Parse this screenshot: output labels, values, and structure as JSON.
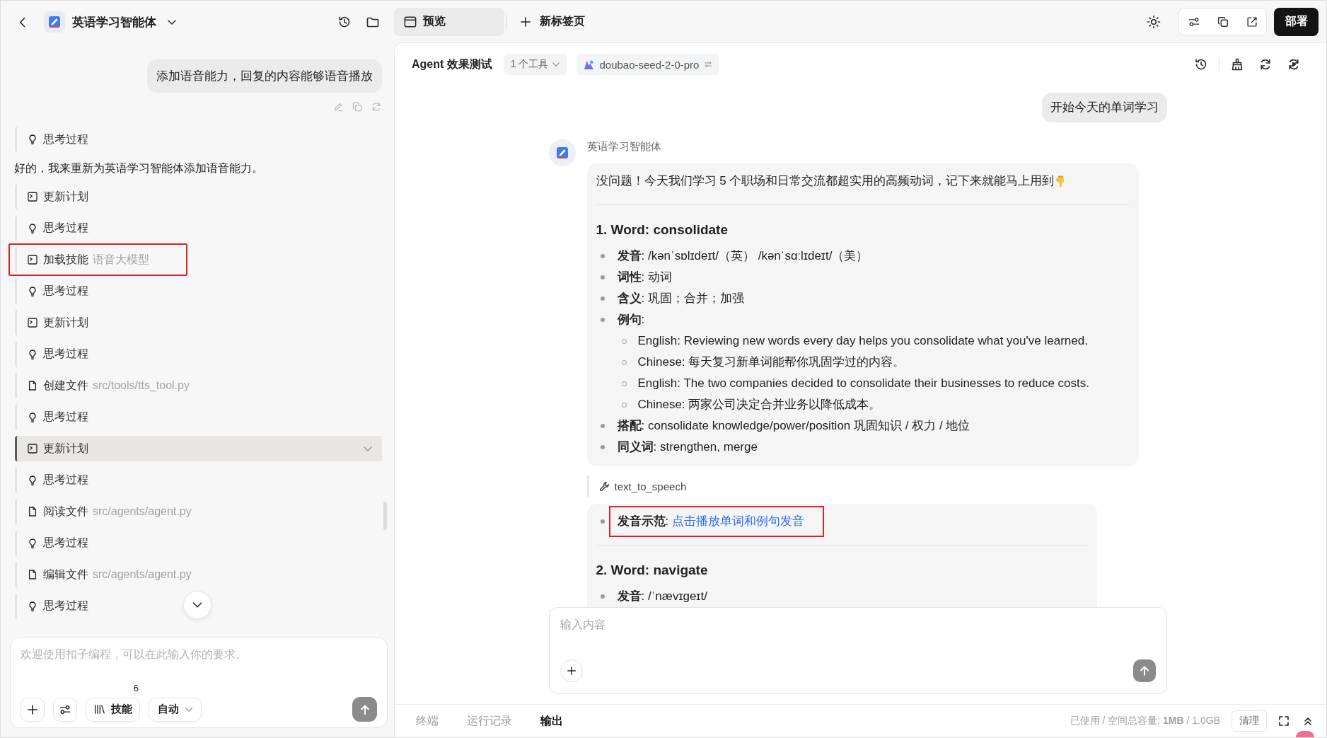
{
  "left_panel": {
    "title": "英语学习智能体",
    "user_message": "添加语音能力，回复的内容能够语音播放",
    "steps": [
      {
        "kind": "thinking",
        "label": "思考过程",
        "selected": false,
        "highlighted": false
      },
      {
        "kind": "text",
        "text": "好的，我来重新为英语学习智能体添加语音能力。"
      },
      {
        "kind": "plan",
        "label": "更新计划",
        "selected": false,
        "highlighted": false
      },
      {
        "kind": "thinking",
        "label": "思考过程",
        "selected": false,
        "highlighted": false
      },
      {
        "kind": "skill",
        "label": "加载技能",
        "detail": "语音大模型",
        "selected": false,
        "highlighted": true
      },
      {
        "kind": "thinking",
        "label": "思考过程",
        "selected": false,
        "highlighted": false
      },
      {
        "kind": "plan",
        "label": "更新计划",
        "selected": false,
        "highlighted": false
      },
      {
        "kind": "thinking",
        "label": "思考过程",
        "selected": false,
        "highlighted": false
      },
      {
        "kind": "file",
        "label": "创建文件",
        "detail": "src/tools/tts_tool.py",
        "selected": false,
        "highlighted": false
      },
      {
        "kind": "thinking",
        "label": "思考过程",
        "selected": false,
        "highlighted": false
      },
      {
        "kind": "plan",
        "label": "更新计划",
        "selected": true,
        "highlighted": false
      },
      {
        "kind": "thinking",
        "label": "思考过程",
        "selected": false,
        "highlighted": false
      },
      {
        "kind": "file",
        "label": "阅读文件",
        "detail": "src/agents/agent.py",
        "selected": false,
        "highlighted": false
      },
      {
        "kind": "thinking",
        "label": "思考过程",
        "selected": false,
        "highlighted": false
      },
      {
        "kind": "file",
        "label": "编辑文件",
        "detail": "src/agents/agent.py",
        "selected": false,
        "highlighted": false
      },
      {
        "kind": "thinking",
        "label": "思考过程",
        "selected": false,
        "highlighted": false
      }
    ],
    "composer": {
      "placeholder": "欢迎使用扣子编程，可以在此输入你的要求。",
      "skills_label": "技能",
      "skills_count": "6",
      "mode": "自动"
    }
  },
  "top_bar": {
    "tabs": [
      {
        "label": "预览",
        "selected": true
      }
    ],
    "new_tab": "新标签页",
    "deploy": "部署"
  },
  "preview": {
    "title": "Agent 效果测试",
    "tools": "1 个工具",
    "model": "doubao-seed-2-0-pro",
    "user_message": "开始今天的单词学习",
    "agent_name": "英语学习智能体",
    "blocks": [
      {
        "kind": "card",
        "intro": "没问题！今天我们学习 5 个职场和日常交流都超实用的高频动词，记下来就能马上用到",
        "sections": [
          {
            "heading": "1. Word: consolidate",
            "bullets": [
              {
                "text": "**发音**: /kənˈsɒlɪdeɪt/（英） /kənˈsɑːlɪdeɪt/（美）",
                "highlighted": false
              },
              {
                "text": "**词性**: 动词",
                "highlighted": false
              },
              {
                "text": "**含义**: 巩固；合并；加强",
                "highlighted": false
              },
              {
                "text": "**例句**:",
                "highlighted": false,
                "children": [
                  {
                    "text": "English: Reviewing new words every day helps you consolidate what you've learned."
                  },
                  {
                    "text": "Chinese: 每天复习新单词能帮你巩固学过的内容。"
                  },
                  {
                    "text": "English: The two companies decided to consolidate their businesses to reduce costs."
                  },
                  {
                    "text": "Chinese: 两家公司决定合并业务以降低成本。"
                  }
                ]
              },
              {
                "text": "**搭配**: consolidate knowledge/power/position 巩固知识 / 权力 / 地位",
                "highlighted": false
              },
              {
                "text": "**同义词**: strengthen, merge",
                "highlighted": false
              }
            ]
          }
        ]
      },
      {
        "kind": "tool",
        "name": "text_to_speech"
      },
      {
        "kind": "card",
        "sections": [
          {
            "bullets": [
              {
                "text": "**发音示范**:",
                "link": "点击播放单词和例句发音",
                "highlighted": true
              }
            ]
          },
          {
            "heading": "2. Word: navigate",
            "bullets": [
              {
                "text": "**发音**: /ˈnævɪɡeɪt/",
                "highlighted": false
              }
            ]
          }
        ]
      }
    ],
    "input_placeholder": "输入内容"
  },
  "bottom_bar": {
    "tabs": [
      {
        "label": "终端",
        "selected": false
      },
      {
        "label": "运行记录",
        "selected": false
      },
      {
        "label": "输出",
        "selected": true
      }
    ],
    "storage": "已使用 / 空间总容量: **1MB** / 1.0GB",
    "clear": "清理"
  }
}
